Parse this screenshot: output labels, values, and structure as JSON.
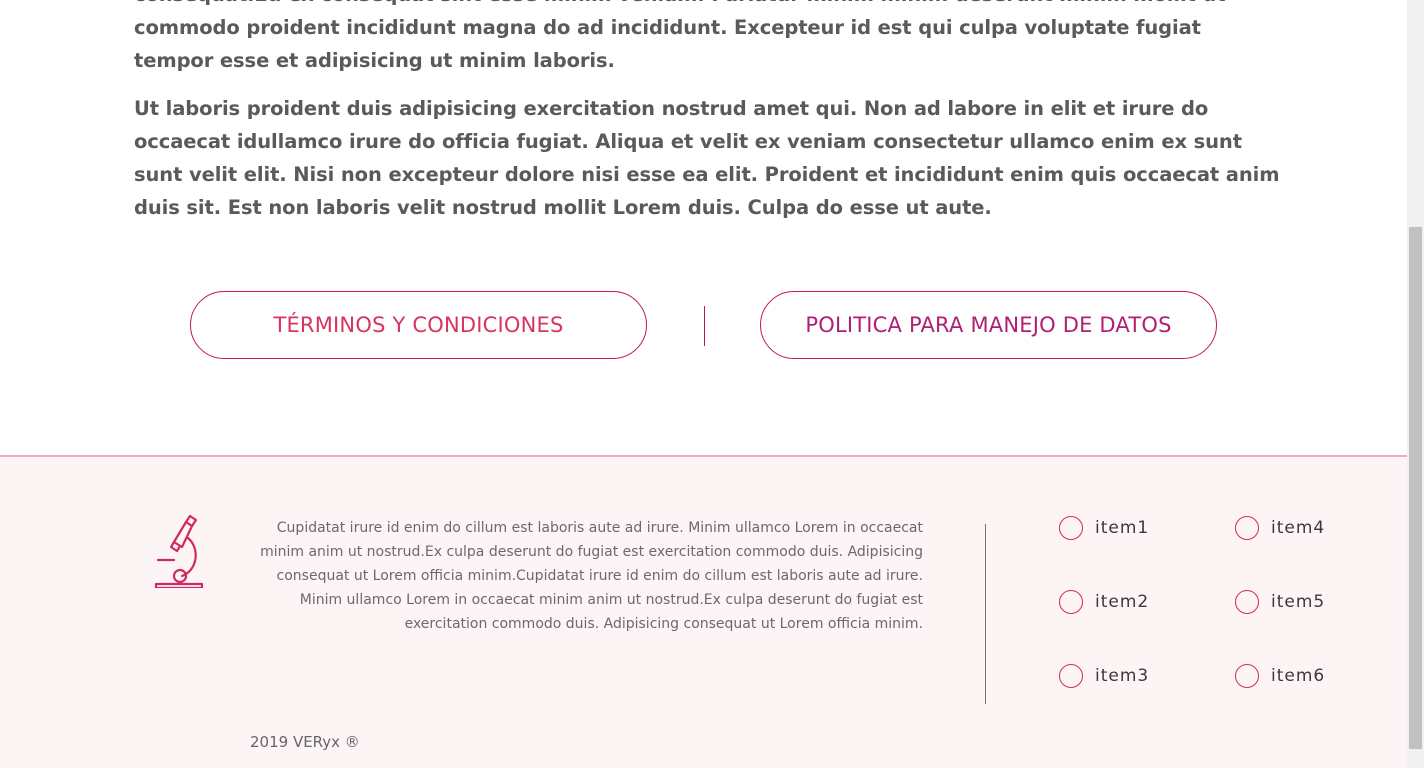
{
  "article": {
    "paragraphs": [
      "consequat.Eu ex consequat sint esse minim veniam. Pariatur minim minim deserunt minim mollit ut commodo proident incididunt magna do ad incididunt. Excepteur id est qui culpa voluptate fugiat tempor esse et adipisicing ut minim laboris.",
      "Ut laboris proident duis adipisicing exercitation nostrud amet qui. Non ad labore in elit et irure do occaecat idullamco irure do officia fugiat. Aliqua et velit ex veniam consectetur ullamco enim ex sunt sunt velit elit. Nisi non excepteur dolore nisi esse ea elit. Proident et incididunt enim quis occaecat anim duis sit. Est non laboris velit nostrud mollit Lorem duis. Culpa do esse ut aute."
    ]
  },
  "buttons": {
    "terms": "TÉRMINOS Y CONDICIONES",
    "policy": "POLITICA PARA MANEJO DE DATOS"
  },
  "footer": {
    "logo_icon": "microscope-icon",
    "text": "Cupidatat irure id enim do cillum est laboris aute ad irure. Minim ullamco Lorem in occaecat minim anim ut nostrud.Ex culpa deserunt do fugiat est exercitation commodo duis. Adipisicing consequat ut Lorem officia minim.Cupidatat irure id enim do cillum est laboris aute ad irure. Minim ullamco Lorem in occaecat minim anim ut nostrud.Ex culpa deserunt do fugiat est exercitation commodo duis. Adipisicing consequat ut Lorem officia minim.",
    "items": [
      "item1",
      "item2",
      "item3",
      "item4",
      "item5",
      "item6"
    ],
    "copyright": "2019 VERyx ®"
  },
  "colors": {
    "accent": "#c2185b",
    "accent_light": "#d8345f",
    "footer_bg": "#fdf4f6",
    "footer_border": "#f3a7c2",
    "body_text": "#5a5a5a"
  }
}
